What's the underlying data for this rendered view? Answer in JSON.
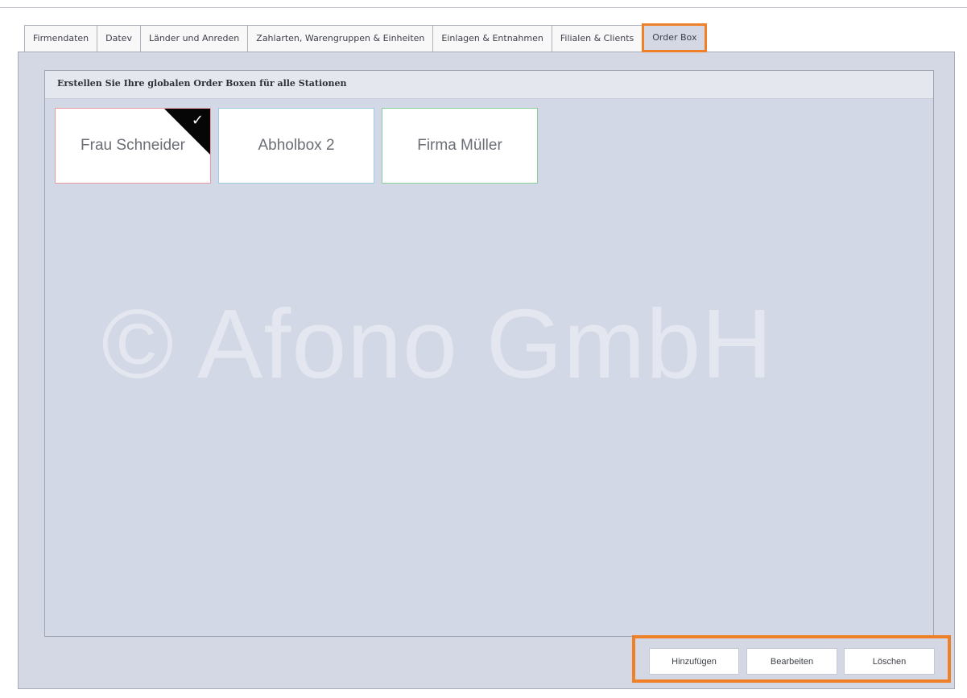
{
  "tabs": [
    {
      "label": "Firmendaten",
      "active": false
    },
    {
      "label": "Datev",
      "active": false
    },
    {
      "label": "Länder und Anreden",
      "active": false
    },
    {
      "label": "Zahlarten, Warengruppen & Einheiten",
      "active": false
    },
    {
      "label": "Einlagen & Entnahmen",
      "active": false
    },
    {
      "label": "Filialen & Clients",
      "active": false
    },
    {
      "label": "Order Box",
      "active": true
    }
  ],
  "group": {
    "title": "Erstellen Sie Ihre globalen Order Boxen für alle Stationen"
  },
  "order_boxes": [
    {
      "label": "Frau Schneider",
      "border_color": "#ec9aa1",
      "selected": true,
      "icon": "checkmark-icon"
    },
    {
      "label": "Abholbox 2",
      "border_color": "#9ecce1",
      "selected": false
    },
    {
      "label": "Firma Müller",
      "border_color": "#89cf98",
      "selected": false
    }
  ],
  "watermark": "© Afono GmbH",
  "buttons": {
    "add": "Hinzufügen",
    "edit": "Bearbeiten",
    "delete": "Löschen"
  },
  "colors": {
    "highlight": "#f08028",
    "panel": "#d4d8e5",
    "tile": "#ffffff"
  }
}
